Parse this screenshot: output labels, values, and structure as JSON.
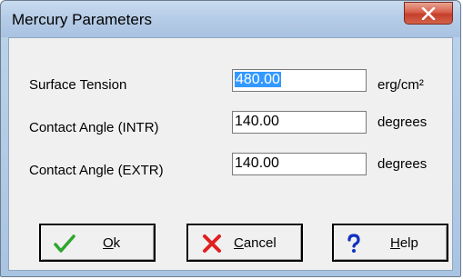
{
  "window": {
    "title": "Mercury Parameters",
    "close_symbol": "X"
  },
  "fields": [
    {
      "label": "Surface Tension",
      "value": "480.00",
      "unit": "erg/cm²",
      "selected": true
    },
    {
      "label": "Contact Angle (INTR)",
      "value": "140.00",
      "unit": "degrees",
      "selected": false
    },
    {
      "label": "Contact Angle (EXTR)",
      "value": "140.00",
      "unit": "degrees",
      "selected": false
    }
  ],
  "buttons": {
    "ok": {
      "mnemonic": "O",
      "rest": "k",
      "icon": "checkmark-icon"
    },
    "cancel": {
      "mnemonic": "C",
      "rest": "ancel",
      "icon": "red-x-icon"
    },
    "help": {
      "mnemonic": "H",
      "rest": "elp",
      "icon": "question-mark-icon"
    }
  },
  "colors": {
    "close_button": "#d9604a",
    "selection": "#3399ff",
    "ok_icon": "#2ea62e",
    "cancel_icon": "#e02020",
    "help_icon": "#1030c0"
  }
}
